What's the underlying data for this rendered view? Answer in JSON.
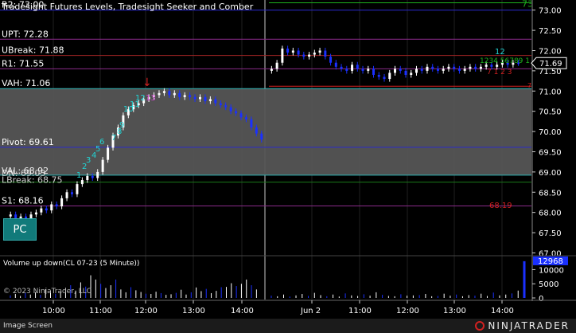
{
  "title": "Tradesight Futures Levels, Tradesight Seeker and Comber",
  "levels": [
    {
      "name": "R2",
      "label": "R2: 73.00",
      "value": 73.0,
      "color": "#2a2ad0"
    },
    {
      "name": "UPT",
      "label": "UPT: 72.28",
      "value": 72.28,
      "color": "#8a2b8a"
    },
    {
      "name": "UBreak",
      "label": "UBreak: 71.88",
      "value": 71.88,
      "color": "#a02424"
    },
    {
      "name": "R1",
      "label": "R1: 71.55",
      "value": 71.55,
      "color": "#8a2b8a"
    },
    {
      "name": "VAH",
      "label": "VAH: 71.06",
      "value": 71.06,
      "color": "#2fb5b5"
    },
    {
      "name": "Pivot",
      "label": "Pivot: 69.61",
      "value": 69.61,
      "color": "#2a2ad0"
    },
    {
      "name": "VAL",
      "label": "VAL: 68.92",
      "value": 68.92,
      "color": "#2fb5b5"
    },
    {
      "name": "LBreak",
      "label": "LBreak: 68.75",
      "value": 68.75,
      "color": "#1a7a1a"
    },
    {
      "name": "S1",
      "label": "S1: 68.16",
      "value": 68.16,
      "color": "#8a2b8a"
    }
  ],
  "overlap_labels": {
    "val": "VAL: 68.92",
    "dn": "DN: 69.03",
    "lbreak": "LBreak: 68.75"
  },
  "price_axis": {
    "ticks": [
      "73.00",
      "72.50",
      "72.00",
      "71.50",
      "71.00",
      "70.50",
      "70.00",
      "69.50",
      "69.00",
      "68.50",
      "68.00",
      "67.50",
      "67.00"
    ],
    "min": 66.95,
    "max": 73.25,
    "current": "71.69",
    "current_value": 71.69
  },
  "right_levels": {
    "green_label": "73",
    "red_label": "68.19",
    "red_value": 68.19,
    "green_value": 73.18,
    "green2": "7"
  },
  "seeker_labels": {
    "top": "12",
    "seq": "1234 56789 1",
    "red_marker": "7 1 2 3"
  },
  "left_counts": [
    "1",
    "2",
    "3",
    "4",
    "5",
    "6",
    "7",
    "8",
    "9",
    "10",
    "11",
    "12",
    "13"
  ],
  "arrow_marker": "↓",
  "pc_button": "PC",
  "volume": {
    "title": "Volume up down(CL 07-23 (5 Minute))",
    "current": "12968",
    "ticks": [
      "10000",
      "5000",
      "0"
    ],
    "max": 13500,
    "bars": [
      900,
      1400,
      700,
      1800,
      1200,
      2000,
      1100,
      3100,
      2500,
      1500,
      2000,
      3300,
      4500,
      2600,
      5500,
      4000,
      8000,
      6500,
      5000,
      3500,
      4500,
      6500,
      3000,
      2000,
      3800,
      2700,
      2100,
      1500,
      1400,
      2200,
      1700,
      1100,
      1300,
      1800,
      2900,
      1200,
      2000,
      3700,
      2400,
      3200,
      1700,
      2500,
      3800,
      3900,
      5200,
      4200,
      5000,
      6500,
      4500,
      3000,
      12968,
      800,
      600,
      1200,
      500,
      900,
      1400,
      700,
      1800,
      1000,
      600,
      1200,
      500,
      1600,
      900,
      700,
      1300,
      800,
      2000,
      1100,
      700,
      600,
      1300,
      800,
      900,
      1000,
      1400,
      600,
      700,
      1500,
      800,
      1200,
      600,
      1000,
      800,
      1500,
      700,
      1900,
      900,
      1200,
      1600,
      2600
    ]
  },
  "copyright": "© 2023 NinjaTrader, LLC",
  "time_ticks": [
    "10:00",
    "11:00",
    "12:00",
    "13:00",
    "14:00",
    "Jun 2",
    "11:00",
    "12:00",
    "13:00",
    "14:00"
  ],
  "status_left": "Image Screen",
  "brand": "NINJATRADER",
  "colors": {
    "up": "#ffffff",
    "down": "#1a30ff",
    "grid": "#202020",
    "band": "#555555"
  }
}
